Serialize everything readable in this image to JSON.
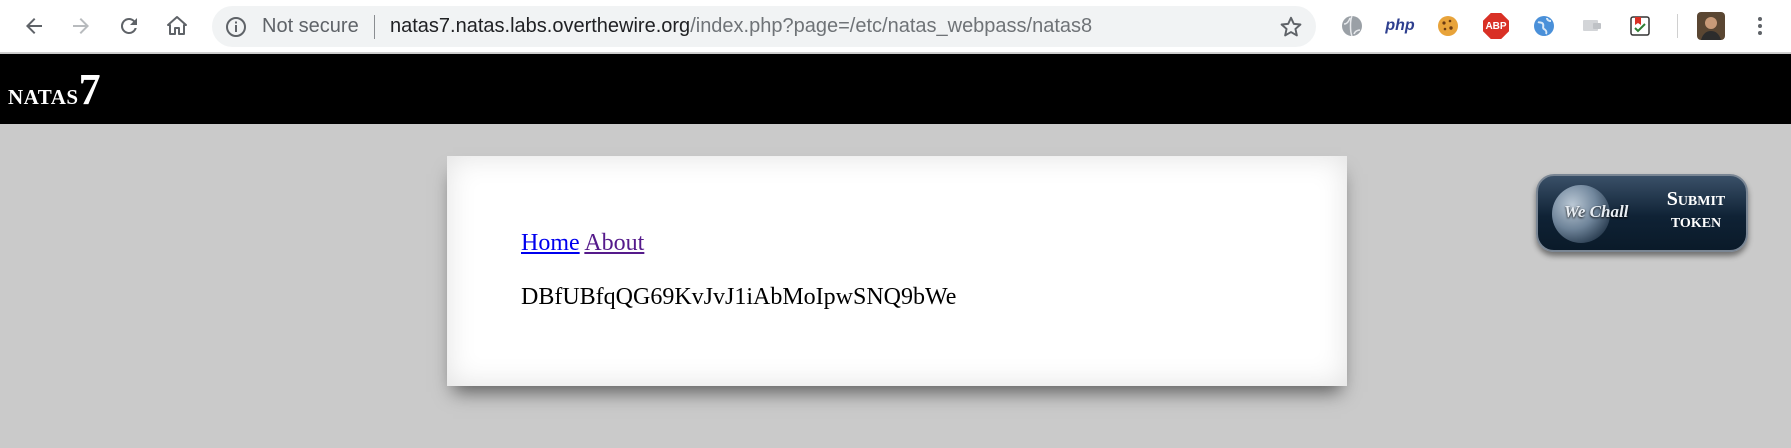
{
  "browser": {
    "security_label": "Not secure",
    "url_host": "natas7.natas.labs.overthewire.org",
    "url_path": "/index.php?page=/etc/natas_webpass/natas8",
    "extensions": [
      {
        "name": "globe-extension",
        "icon": "globe-icon"
      },
      {
        "name": "php-extension",
        "label": "php"
      },
      {
        "name": "cookie-extension",
        "icon": "cookie-icon"
      },
      {
        "name": "adblock-plus-extension",
        "label": "ABP"
      },
      {
        "name": "world-extension",
        "icon": "world-icon"
      },
      {
        "name": "screen-extension",
        "icon": "screen-icon"
      },
      {
        "name": "bookmark-extension",
        "icon": "bookmark-icon"
      }
    ],
    "accent_color": "#d93025"
  },
  "header": {
    "logo_text": "natas",
    "logo_number": "7"
  },
  "content": {
    "nav": [
      {
        "label": "Home"
      },
      {
        "label": "About"
      }
    ],
    "password": "DBfUBfqQG69KvJvJ1iAbMoIpwSNQ9bWe"
  },
  "wechall": {
    "brand": "We Chall",
    "cta_line1": "Submit",
    "cta_line2": "token"
  }
}
